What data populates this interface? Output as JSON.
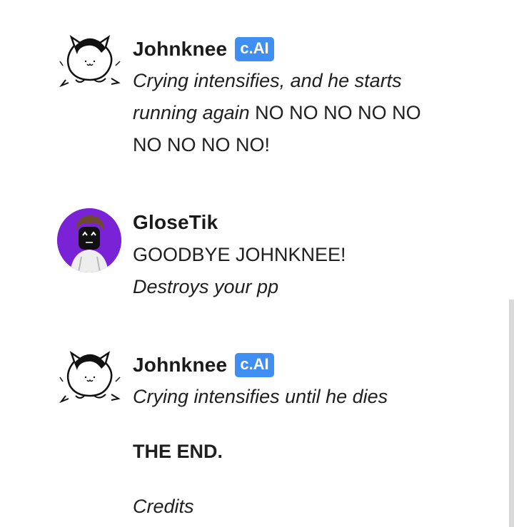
{
  "messages": [
    {
      "author": "Johnknee",
      "badge": "c.AI",
      "avatar_icon": "cat-doodle-avatar",
      "italic": "Crying intensifies, and he starts running again",
      "normal": " NO NO NO NO NO NO NO NO NO!"
    },
    {
      "author": "GloseTik",
      "avatar_icon": "purple-character-avatar",
      "line1": "GOODBYE JOHNKNEE!",
      "line2_italic": "Destroys your pp"
    },
    {
      "author": "Johnknee",
      "badge": "c.AI",
      "avatar_icon": "cat-doodle-avatar",
      "line1_italic": "Crying intensifies until he dies",
      "line2_bold": "THE END.",
      "line3_italic": "Credits"
    }
  ],
  "colors": {
    "badge_bg": "#3f8ff2",
    "avatar2_bg": "#7a22d6"
  }
}
